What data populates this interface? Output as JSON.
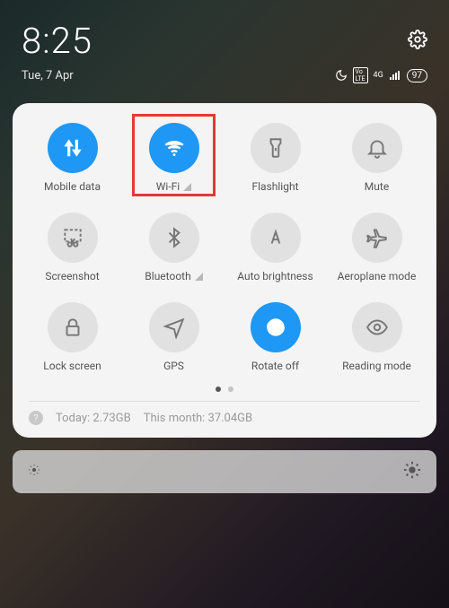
{
  "status": {
    "time": "8:25",
    "date": "Tue, 7 Apr",
    "battery": "97",
    "indicators": {
      "volte": "Vo LTE",
      "net": "4G"
    }
  },
  "tiles": {
    "mobile_data": "Mobile data",
    "wifi": "Wi-Fi",
    "flashlight": "Flashlight",
    "mute": "Mute",
    "screenshot": "Screenshot",
    "bluetooth": "Bluetooth",
    "auto_brightness": "Auto brightness",
    "aeroplane": "Aeroplane mode",
    "lock_screen": "Lock screen",
    "gps": "GPS",
    "rotate_off": "Rotate off",
    "reading_mode": "Reading mode"
  },
  "usage": {
    "today_label": "Today:",
    "today_value": "2.73GB",
    "month_label": "This month:",
    "month_value": "37.04GB"
  },
  "colors": {
    "accent": "#1f97f4",
    "highlight": "#e03a3a"
  }
}
